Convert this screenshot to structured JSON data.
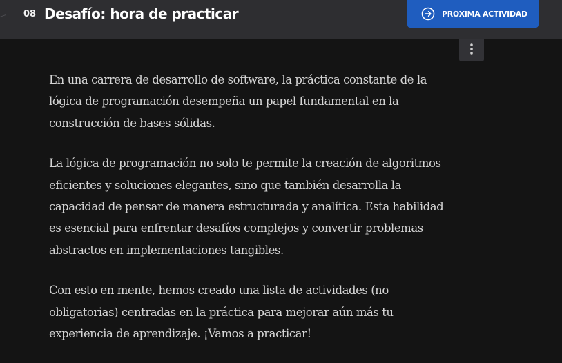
{
  "header": {
    "lesson_number": "08",
    "lesson_title": "Desafío: hora de practicar",
    "next_button_label": "PRÓXIMA ACTIVIDAD",
    "next_icon": "arrow-right-circle-icon",
    "menu_icon": "vertical-dots-icon"
  },
  "content": {
    "paragraphs": [
      "En una carrera de desarrollo de software, la práctica constante de la lógica de programación desempeña un papel fundamental en la construcción de bases sólidas.",
      "La lógica de programación no solo te permite la creación de algoritmos eficientes y soluciones elegantes, sino que también desarrolla la capacidad de pensar de manera estructurada y analítica. Esta habilidad es esencial para enfrentar desafíos complejos y convertir problemas abstractos en implementaciones tangibles.",
      "Con esto en mente, hemos creado una lista de actividades (no obligatorias) centradas en la práctica para mejorar aún más tu experiencia de aprendizaje. ¡Vamos a practicar!"
    ]
  },
  "colors": {
    "header_bg": "#2e2e31",
    "page_bg": "#141414",
    "accent": "#1f5dbf",
    "text": "#d4d4d4"
  }
}
